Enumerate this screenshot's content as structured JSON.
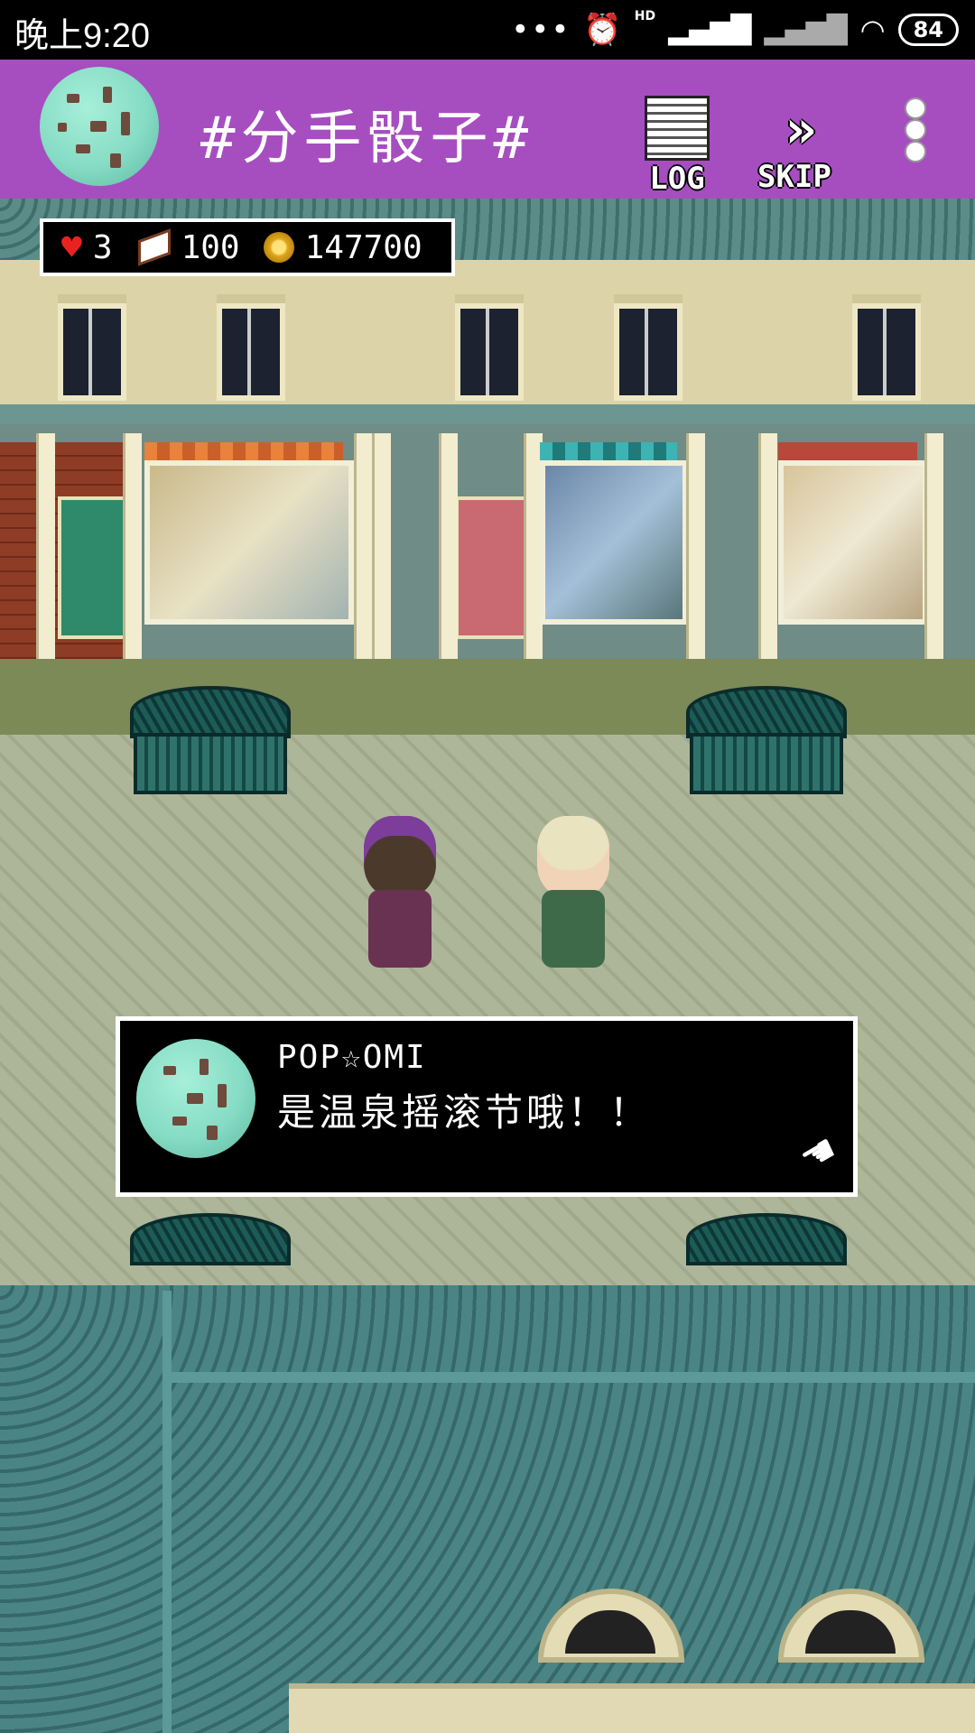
{
  "status_bar": {
    "time": "晚上9:20",
    "network_label": "HD",
    "battery": "84"
  },
  "header": {
    "title": "#分手骰子#",
    "log_label": "LOG",
    "skip_label": "SKIP"
  },
  "hud": {
    "hearts": "3",
    "books": "100",
    "coins": "147700"
  },
  "dialog": {
    "speaker": "POP☆OMI",
    "text": "是温泉摇滚节哦！！"
  },
  "colors": {
    "header_bg": "#a64ec0",
    "dialog_bg": "#000000",
    "avatar": "#86dcc4"
  },
  "icons": [
    "avatar-icon",
    "log-icon",
    "skip-icon",
    "more-icon",
    "heart-icon",
    "book-icon",
    "coin-icon",
    "pointer-hand-icon"
  ]
}
